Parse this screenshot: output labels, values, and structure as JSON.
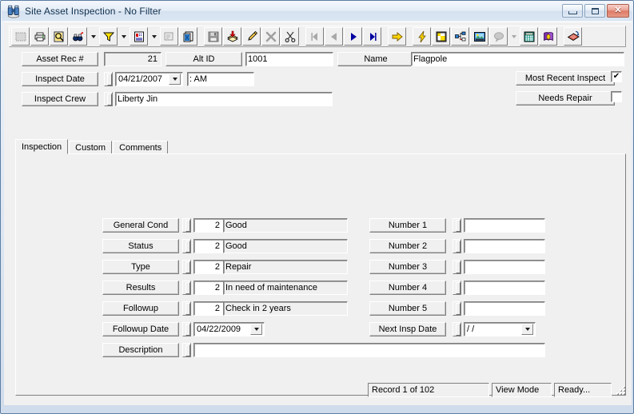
{
  "window": {
    "title": "Site Asset Inspection - No Filter",
    "app_icon": "app-binoculars-icon",
    "minimize": "minimize",
    "maximize": "maximize",
    "close": "close"
  },
  "toolbar": {
    "buttons": [
      {
        "name": "select-all-icon",
        "tip": "Select",
        "disabled": true
      },
      {
        "name": "print-icon",
        "tip": "Print"
      },
      {
        "name": "print-preview-icon",
        "tip": "Print Preview"
      },
      {
        "name": "find-icon",
        "tip": "Find"
      },
      {
        "name": "find-dropdown-icon",
        "tip": "Find Options",
        "drop": true
      },
      {
        "name": "filter-icon",
        "tip": "Filter"
      },
      {
        "name": "filter-dropdown-icon",
        "tip": "Filter Options",
        "drop": true
      },
      {
        "name": "report-icon",
        "tip": "Report"
      },
      {
        "name": "report-dropdown-icon",
        "tip": "Report Options",
        "drop": true
      },
      {
        "name": "properties-icon",
        "tip": "Properties",
        "disabled": true
      },
      {
        "name": "copy-record-icon",
        "tip": "Copy Record"
      },
      {
        "name": "sep1",
        "sep": true
      },
      {
        "name": "save-icon",
        "tip": "Save",
        "disabled": true
      },
      {
        "name": "new-record-icon",
        "tip": "New Record"
      },
      {
        "name": "edit-icon",
        "tip": "Edit"
      },
      {
        "name": "delete-icon",
        "tip": "Delete",
        "disabled": true
      },
      {
        "name": "cut-icon",
        "tip": "Cut"
      },
      {
        "name": "sep2",
        "sep": true
      },
      {
        "name": "first-record-icon",
        "tip": "First Record",
        "disabled": true
      },
      {
        "name": "previous-record-icon",
        "tip": "Previous Record",
        "disabled": true
      },
      {
        "name": "next-record-icon",
        "tip": "Next Record"
      },
      {
        "name": "last-record-icon",
        "tip": "Last Record"
      },
      {
        "name": "sep3",
        "sep": true
      },
      {
        "name": "goto-icon",
        "tip": "Go To"
      },
      {
        "name": "sep4",
        "sep": true
      },
      {
        "name": "lightning-icon",
        "tip": "Quick Action"
      },
      {
        "name": "map-icon",
        "tip": "Map"
      },
      {
        "name": "tree-view-icon",
        "tip": "Tree View"
      },
      {
        "name": "image-icon",
        "tip": "Image"
      },
      {
        "name": "comment-icon",
        "tip": "Comment",
        "disabled": true
      },
      {
        "name": "comment-dropdown-icon",
        "tip": "Comment Options",
        "drop": true,
        "disabled": true
      },
      {
        "name": "calculator-icon",
        "tip": "Calculator"
      },
      {
        "name": "help-icon",
        "tip": "Help"
      },
      {
        "name": "sep5",
        "sep": true
      },
      {
        "name": "exit-icon",
        "tip": "Exit"
      }
    ]
  },
  "header": {
    "asset_rec_label": "Asset Rec #",
    "asset_rec_value": "21",
    "alt_id_label": "Alt ID",
    "alt_id_value": "1001",
    "name_label": "Name",
    "name_value": "Flagpole",
    "inspect_date_label": "Inspect Date",
    "inspect_date_value": "04/21/2007",
    "inspect_time_value": ":  AM",
    "inspect_crew_label": "Inspect Crew",
    "inspect_crew_value": "Liberty Jin",
    "most_recent_label": "Most Recent Inspect",
    "most_recent_checked": "✔",
    "needs_repair_label": "Needs Repair",
    "needs_repair_checked": ""
  },
  "tabs": [
    {
      "label": "Inspection",
      "active": true
    },
    {
      "label": "Custom",
      "active": false
    },
    {
      "label": "Comments",
      "active": false
    }
  ],
  "inspection": {
    "left_rows": [
      {
        "label": "General Cond",
        "code": "2",
        "text": "Good"
      },
      {
        "label": "Status",
        "code": "2",
        "text": "Good"
      },
      {
        "label": "Type",
        "code": "2",
        "text": "Repair"
      },
      {
        "label": "Results",
        "code": "2",
        "text": "In need of maintenance"
      },
      {
        "label": "Followup",
        "code": "2",
        "text": "Check in 2 years"
      }
    ],
    "followup_date_label": "Followup Date",
    "followup_date_value": "04/22/2009",
    "description_label": "Description",
    "description_value": "",
    "right_rows": [
      {
        "label": "Number 1",
        "value": ""
      },
      {
        "label": "Number 2",
        "value": ""
      },
      {
        "label": "Number 3",
        "value": ""
      },
      {
        "label": "Number 4",
        "value": ""
      },
      {
        "label": "Number 5",
        "value": ""
      }
    ],
    "next_insp_date_label": "Next Insp Date",
    "next_insp_date_value": "/  /"
  },
  "status": {
    "record": "Record 1 of 102",
    "mode": "View Mode",
    "state": "Ready..."
  },
  "colors": {
    "face": "#f0f0f0",
    "title_text": "#11314e",
    "accent_yellow": "#ffd700",
    "accent_blue": "#0000a0"
  }
}
